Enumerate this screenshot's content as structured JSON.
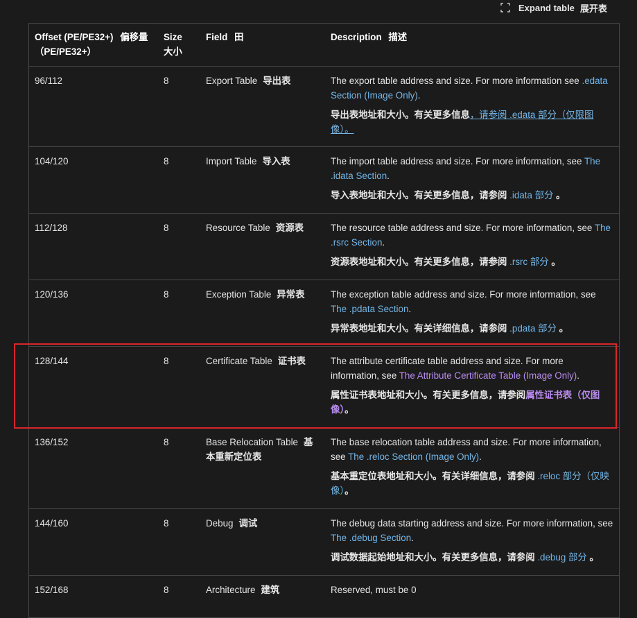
{
  "toolbar": {
    "expand_label": "Expand table",
    "expand_label_cn": "展开表",
    "expand_icon": "expand-icon"
  },
  "headers": {
    "offset": "Offset (PE/PE32+)",
    "offset_cn": "偏移量（PE/PE32+）",
    "size": "Size",
    "size_cn": "大小",
    "field": "Field",
    "field_cn": "田",
    "description": "Description",
    "description_cn": "描述"
  },
  "rows": [
    {
      "offset": "96/112",
      "size": "8",
      "field": "Export Table",
      "field_cn": "导出表",
      "desc_en": "The export table address and size. For more information see ",
      "desc_en_link": ".edata Section (Image Only)",
      "desc_en_tail": ".",
      "desc_cn": "导出表地址和大小。有关更多信息",
      "desc_cn_link": "，请参阅 .edata 部分（仅限图像）。",
      "desc_cn_tail": ""
    },
    {
      "offset": "104/120",
      "size": "8",
      "field": "Import Table",
      "field_cn": "导入表",
      "desc_en": "The import table address and size. For more information, see ",
      "desc_en_link": "The .idata Section",
      "desc_en_tail": ".",
      "desc_cn": "导入表地址和大小。有关更多信息，请参阅 ",
      "desc_cn_link": ".idata 部分",
      "desc_cn_tail": " 。"
    },
    {
      "offset": "112/128",
      "size": "8",
      "field": "Resource Table",
      "field_cn": "资源表",
      "desc_en": "The resource table address and size. For more information, see ",
      "desc_en_link": "The .rsrc Section",
      "desc_en_tail": ".",
      "desc_cn": "资源表地址和大小。有关更多信息，请参阅 ",
      "desc_cn_link": ".rsrc 部分",
      "desc_cn_tail": " 。"
    },
    {
      "offset": "120/136",
      "size": "8",
      "field": "Exception Table",
      "field_cn": "异常表",
      "desc_en": "The exception table address and size. For more information, see ",
      "desc_en_link": "The .pdata Section",
      "desc_en_tail": ".",
      "desc_cn": "异常表地址和大小。有关详细信息，请参阅 ",
      "desc_cn_link": ".pdata 部分",
      "desc_cn_tail": " 。"
    },
    {
      "offset": "128/144",
      "size": "8",
      "field": "Certificate Table",
      "field_cn": "证书表",
      "desc_en": "The attribute certificate table address and size. For more information, see ",
      "desc_en_link": "The Attribute Certificate Table (Image Only)",
      "desc_en_tail": ".",
      "desc_cn": "属性证书表地址和大小。有关更多信息，请参阅",
      "desc_cn_link": "属性证书表（仅图像）",
      "desc_cn_tail": "。"
    },
    {
      "offset": "136/152",
      "size": "8",
      "field": "Base Relocation Table",
      "field_cn": "基本重新定位表",
      "desc_en": "The base relocation table address and size. For more information, see ",
      "desc_en_link": "The .reloc Section (Image Only)",
      "desc_en_tail": ".",
      "desc_cn": "基本重定位表地址和大小。有关详细信息，请参阅 ",
      "desc_cn_link": ".reloc 部分（仅映像）",
      "desc_cn_tail": "。"
    },
    {
      "offset": "144/160",
      "size": "8",
      "field": "Debug",
      "field_cn": "调试",
      "desc_en": "The debug data starting address and size. For more information, see ",
      "desc_en_link": "The .debug Section",
      "desc_en_tail": ".",
      "desc_cn": "调试数据起始地址和大小。有关更多信息，请参阅 ",
      "desc_cn_link": ".debug 部分",
      "desc_cn_tail": " 。"
    },
    {
      "offset": "152/168",
      "size": "8",
      "field": "Architecture",
      "field_cn": "建筑",
      "desc_en": "Reserved, must be 0"
    }
  ],
  "colors": {
    "background": "#1b1b1b",
    "border": "#474747",
    "link": "#75b6e7",
    "visited_link": "#b98bf0",
    "highlight": "#d9262b"
  }
}
